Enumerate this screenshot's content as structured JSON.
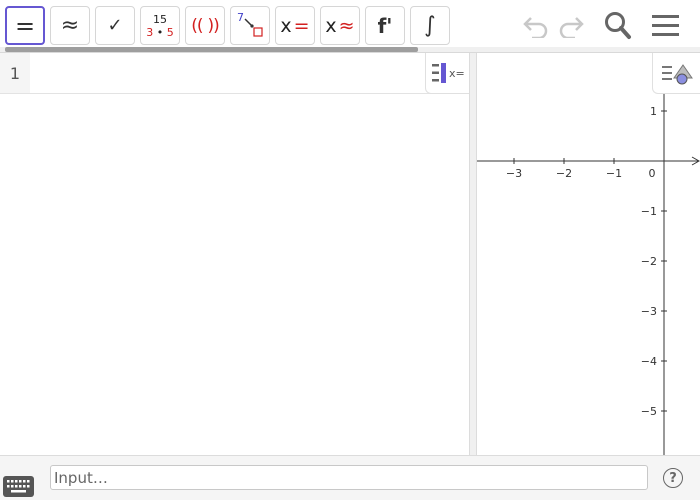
{
  "toolbar": {
    "tools": {
      "evaluate": {
        "symbol": "=",
        "icon": "equals-icon"
      },
      "numeric": {
        "symbol": "≈",
        "icon": "approx-icon"
      },
      "keep_input": {
        "symbol": "✓",
        "icon": "check-icon"
      },
      "factor": {
        "top": "15",
        "bottom_left": "3",
        "dot": "•",
        "bottom_right": "5",
        "icon": "factor-icon"
      },
      "expand": {
        "symbol_open": "((",
        "symbol_close": "))",
        "icon": "expand-icon"
      },
      "substitute": {
        "label": "7",
        "icon": "substitute-icon"
      },
      "solve": {
        "x": "x",
        "op": "=",
        "icon": "solve-icon"
      },
      "nsolve": {
        "x": "x",
        "op": "≈",
        "icon": "nsolve-icon"
      },
      "derivative": {
        "symbol": "f'",
        "icon": "derivative-icon"
      },
      "integral": {
        "symbol": "∫",
        "icon": "integral-icon"
      }
    },
    "undo_icon": "undo-icon",
    "redo_icon": "redo-icon",
    "search_icon": "search-icon",
    "menu_icon": "hamburger-menu-icon"
  },
  "cas": {
    "rows": [
      {
        "number": "1",
        "content": ""
      }
    ],
    "style_toggle_label": "x="
  },
  "graphics": {
    "x_ticks": [
      "−3",
      "−2",
      "−1",
      "0"
    ],
    "y_ticks": [
      "1",
      "−1",
      "−2",
      "−3",
      "−4",
      "−5"
    ],
    "style_toggle_icon": "graphics-style-icon"
  },
  "input_bar": {
    "placeholder": "Input…",
    "value": "",
    "keyboard_icon": "keyboard-icon",
    "help_label": "?"
  },
  "colors": {
    "accent": "#6557d2",
    "red": "#d32020",
    "point": "#8b8fe0"
  }
}
